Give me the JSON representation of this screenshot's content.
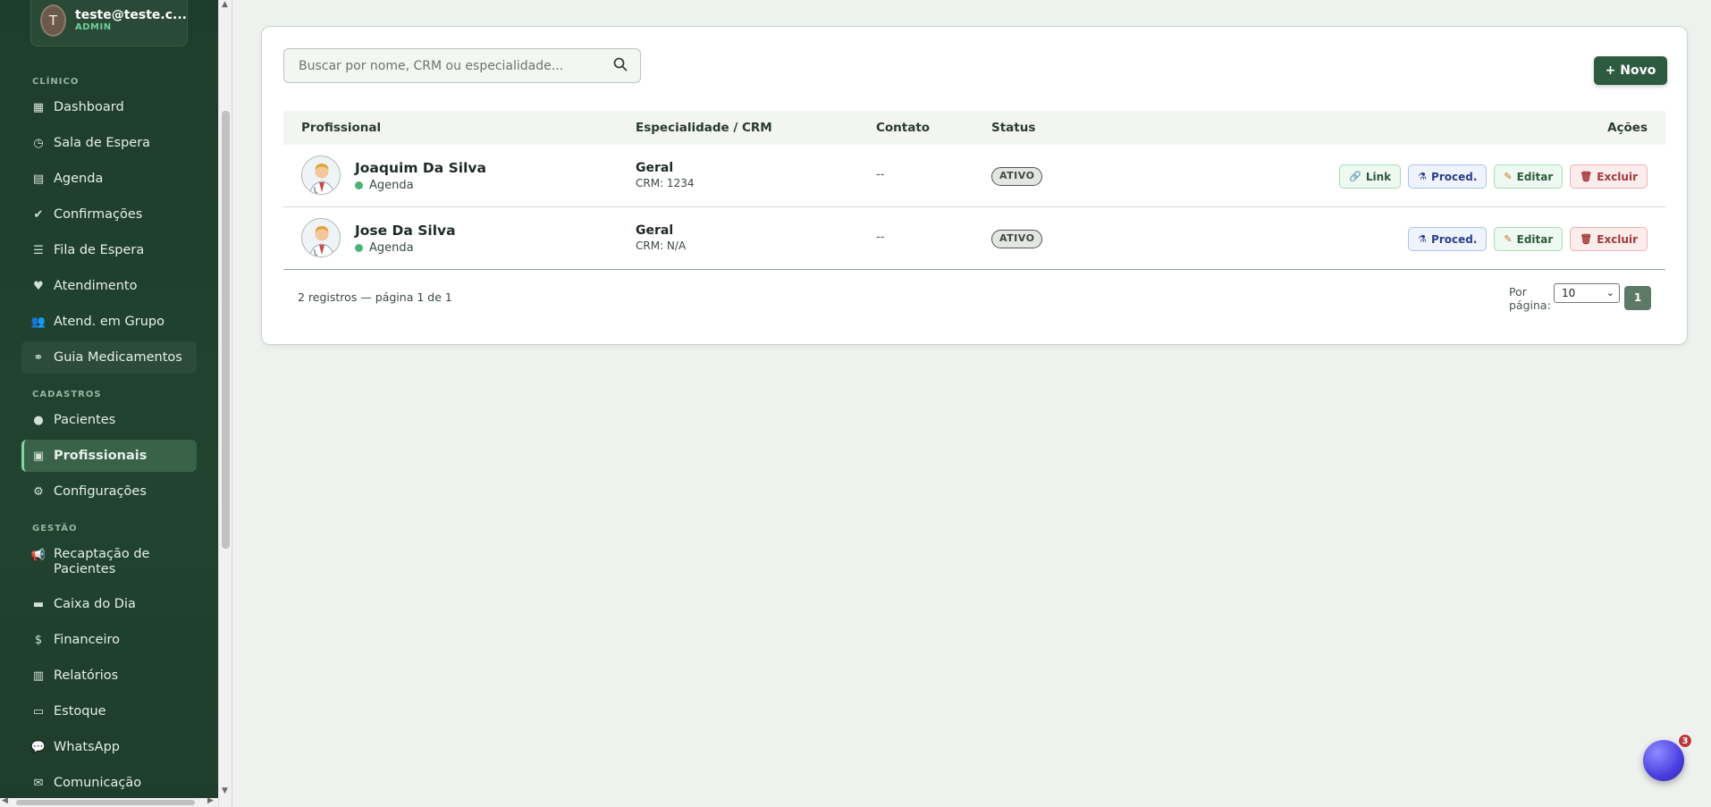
{
  "user": {
    "initial": "T",
    "email": "teste@teste.c...",
    "role": "ADMIN"
  },
  "sidebar": {
    "sections": [
      {
        "label": "CLÍNICO"
      },
      {
        "label": "CADASTROS"
      },
      {
        "label": "GESTÃO"
      }
    ],
    "items": [
      {
        "label": "Dashboard",
        "icon": "grid-icon"
      },
      {
        "label": "Sala de Espera",
        "icon": "clock-icon"
      },
      {
        "label": "Agenda",
        "icon": "calendar-icon"
      },
      {
        "label": "Confirmações",
        "icon": "check-circle-icon"
      },
      {
        "label": "Fila de Espera",
        "icon": "list-icon"
      },
      {
        "label": "Atendimento",
        "icon": "heartbeat-icon"
      },
      {
        "label": "Atend. em Grupo",
        "icon": "users-icon"
      },
      {
        "label": "Guia Medicamentos",
        "icon": "pills-icon"
      },
      {
        "label": "Pacientes",
        "icon": "user-icon"
      },
      {
        "label": "Profissionais",
        "icon": "id-badge-icon"
      },
      {
        "label": "Configurações",
        "icon": "gear-icon"
      },
      {
        "label": "Recaptação de Pacientes",
        "icon": "megaphone-icon"
      },
      {
        "label": "Caixa do Dia",
        "icon": "briefcase-icon"
      },
      {
        "label": "Financeiro",
        "icon": "money-icon"
      },
      {
        "label": "Relatórios",
        "icon": "bar-chart-icon"
      },
      {
        "label": "Estoque",
        "icon": "box-icon"
      },
      {
        "label": "WhatsApp",
        "icon": "chat-icon"
      },
      {
        "label": "Comunicação",
        "icon": "mail-icon"
      }
    ]
  },
  "search": {
    "placeholder": "Buscar por nome, CRM ou especialidade...",
    "value": ""
  },
  "toolbar": {
    "new_label": "+ Novo"
  },
  "table": {
    "headers": [
      "Profissional",
      "Especialidade / CRM",
      "Contato",
      "Status",
      "Ações"
    ],
    "rows": [
      {
        "name": "Joaquim Da Silva",
        "agenda": "Agenda",
        "specialty": "Geral",
        "crm": "CRM: 1234",
        "contact": "--",
        "status": "ATIVO",
        "actions": {
          "link": "Link",
          "proc": "Proced.",
          "edit": "Editar",
          "delete": "Excluir"
        }
      },
      {
        "name": "Jose Da Silva",
        "agenda": "Agenda",
        "specialty": "Geral",
        "crm": "CRM: N/A",
        "contact": "--",
        "status": "ATIVO",
        "actions": {
          "proc": "Proced.",
          "edit": "Editar",
          "delete": "Excluir"
        }
      }
    ]
  },
  "pagination": {
    "summary": "2 registros — página 1 de 1",
    "per_page_label": "Por página:",
    "per_page_value": "10",
    "current_page": "1"
  },
  "widget": {
    "badge_count": "3"
  },
  "colors": {
    "sidebar_bg": "#1f3d2c",
    "accent": "#2e5b40",
    "active_green": "#4cb277"
  }
}
